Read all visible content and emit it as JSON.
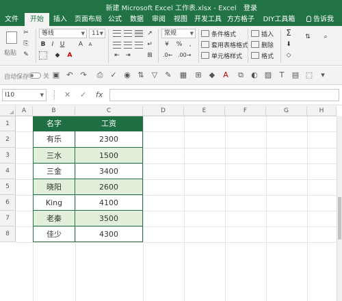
{
  "window": {
    "title": "新建 Microsoft Excel 工作表.xlsx - Excel",
    "login": "登录"
  },
  "tabs": [
    {
      "label": "文件",
      "active": false
    },
    {
      "label": "开始",
      "active": true
    },
    {
      "label": "插入",
      "active": false
    },
    {
      "label": "页面布局",
      "active": false
    },
    {
      "label": "公式",
      "active": false
    },
    {
      "label": "数据",
      "active": false
    },
    {
      "label": "审阅",
      "active": false
    },
    {
      "label": "视图",
      "active": false
    },
    {
      "label": "开发工具",
      "active": false
    },
    {
      "label": "方方格子",
      "active": false
    },
    {
      "label": "DIY工具箱",
      "active": false
    },
    {
      "label": "告诉我",
      "active": false
    }
  ],
  "ribbon": {
    "paste_label": "粘贴",
    "font_name": "等线",
    "font_size": "11",
    "number_format": "常规",
    "cell_insert_label": "插入",
    "cell_delete_label": "删除",
    "cell_format_label": "格式",
    "cond_format_label": "条件格式",
    "table_format_label": "套用表格格式",
    "cell_style_label": "单元格样式",
    "bold": "B",
    "italic": "I",
    "underline": "U",
    "font_color_glyph": "A",
    "currency_glyph": "¥",
    "percent_glyph": "%",
    "comma_glyph": ","
  },
  "qat": {
    "autosave_label": "自动保存",
    "autosave_state": "关"
  },
  "formula_bar": {
    "name_box": "I10",
    "cancel_glyph": "✕",
    "confirm_glyph": "✓",
    "fx_label": "fx",
    "formula": ""
  },
  "sheet": {
    "columns": [
      "A",
      "B",
      "C",
      "D",
      "E",
      "F",
      "G",
      "H"
    ],
    "rows": [
      "1",
      "2",
      "3",
      "4",
      "5",
      "6",
      "7",
      "8"
    ],
    "table_header": [
      "名字",
      "工资"
    ],
    "table_rows": [
      [
        "有乐",
        "2300"
      ],
      [
        "三水",
        "1500"
      ],
      [
        "三金",
        "3400"
      ],
      [
        "晓阳",
        "2600"
      ],
      [
        "King",
        "4100"
      ],
      [
        "老秦",
        "3500"
      ],
      [
        "佳少",
        "4300"
      ]
    ]
  },
  "colors": {
    "excel_green": "#217346",
    "header_fill": "#1f6f45",
    "band_fill": "#e2efda"
  }
}
